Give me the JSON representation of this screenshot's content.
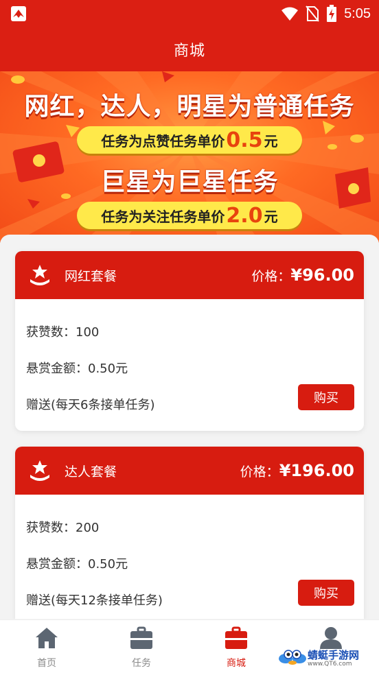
{
  "status_bar": {
    "time": "5:05",
    "icons": [
      "wifi-icon",
      "no-sim-icon",
      "battery-charging-icon"
    ]
  },
  "header": {
    "title": "商城"
  },
  "banner": {
    "line1": "网红，达人，明星为普通任务",
    "pill1_prefix": "任务为点赞任务单价",
    "pill1_value": "0.5",
    "pill1_unit": "元",
    "line2": "巨星为巨星任务",
    "pill2_prefix": "任务为关注任务单价",
    "pill2_value": "2.0",
    "pill2_unit": "元"
  },
  "packages": [
    {
      "name": "网红套餐",
      "price_label": "价格：",
      "price": "¥96.00",
      "likes": "获赞数：100",
      "reward": "悬赏金额：0.50元",
      "bonus": "赠送(每天6条接单任务)",
      "buy_label": "购买"
    },
    {
      "name": "达人套餐",
      "price_label": "价格：",
      "price": "¥196.00",
      "likes": "获赞数：200",
      "reward": "悬赏金额：0.50元",
      "bonus": "赠送(每天12条接单任务)",
      "buy_label": "购买"
    }
  ],
  "tabbar": {
    "items": [
      {
        "label": "首页",
        "icon": "home-icon"
      },
      {
        "label": "任务",
        "icon": "briefcase-icon"
      },
      {
        "label": "商城",
        "icon": "shop-bag-icon",
        "active": true
      },
      {
        "label": "",
        "icon": "user-icon"
      }
    ]
  },
  "watermark": {
    "text": "蜻蜓手游网",
    "url": "www.QT6.com"
  },
  "colors": {
    "brand_red": "#db1f13",
    "card_red": "#d71c10",
    "pill_yellow": "#ffe94a"
  }
}
